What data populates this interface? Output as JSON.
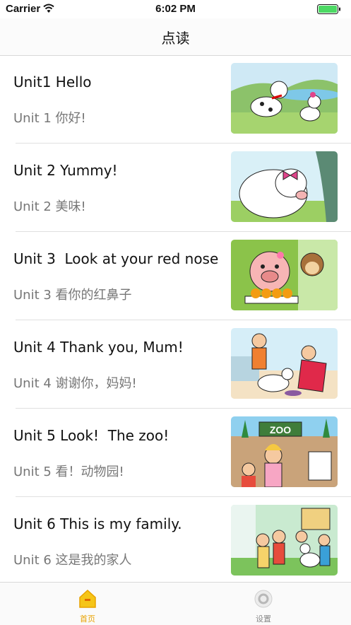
{
  "status_bar": {
    "carrier": "Carrier",
    "time": "6:02 PM"
  },
  "nav": {
    "title": "点读"
  },
  "units": [
    {
      "title": "Unit1 Hello",
      "subtitle": "Unit 1 你好!",
      "image": "dalmatian-and-poodle-picture"
    },
    {
      "title": "Unit 2 Yummy!",
      "subtitle": "Unit 2 美味!",
      "image": "poodle-with-bow-picture"
    },
    {
      "title": "Unit 3  Look at your red nose",
      "subtitle": "Unit 3 看你的红鼻子",
      "image": "pig-and-monkey-picture"
    },
    {
      "title": "Unit 4 Thank you, Mum!",
      "subtitle": "Unit 4 谢谢你，妈妈!",
      "image": "family-kitchen-picture"
    },
    {
      "title": "Unit 5 Look!  The zoo!",
      "subtitle": "Unit 5 看！动物园!",
      "image": "zoo-gate-picture"
    },
    {
      "title": "Unit 6 This is my family.",
      "subtitle": "Unit 6 这是我的家人",
      "image": "family-with-dog-picture"
    }
  ],
  "tabs": [
    {
      "label": "首页",
      "icon": "home-icon",
      "active": true
    },
    {
      "label": "设置",
      "icon": "settings-icon",
      "active": false
    }
  ],
  "colors": {
    "accent": "#e8a200",
    "separator": "#e0e0e0",
    "subtitle": "#777777"
  }
}
